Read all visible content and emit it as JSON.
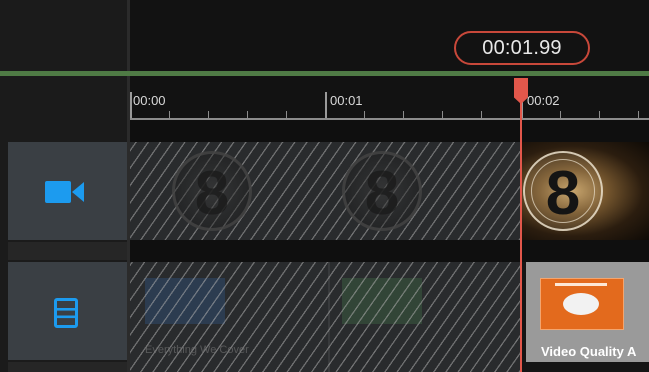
{
  "timecode": "00:01.99",
  "ruler": {
    "labels": [
      "00:00",
      "00:01",
      "00:02"
    ]
  },
  "tracks": [
    {
      "name": "video",
      "icon": "video-camera-icon",
      "leader_number": "8"
    },
    {
      "name": "slides",
      "icon": "list-icon",
      "clips": [
        {
          "label": "Everything We Cover",
          "disabled": true
        },
        {
          "label": "Video Quality A",
          "disabled": false
        }
      ]
    }
  ],
  "colors": {
    "accent_blue": "#1c9bef",
    "playhead_red": "#e2574b",
    "green_bar": "#4f7b45",
    "slide_orange": "#e36a1d"
  }
}
